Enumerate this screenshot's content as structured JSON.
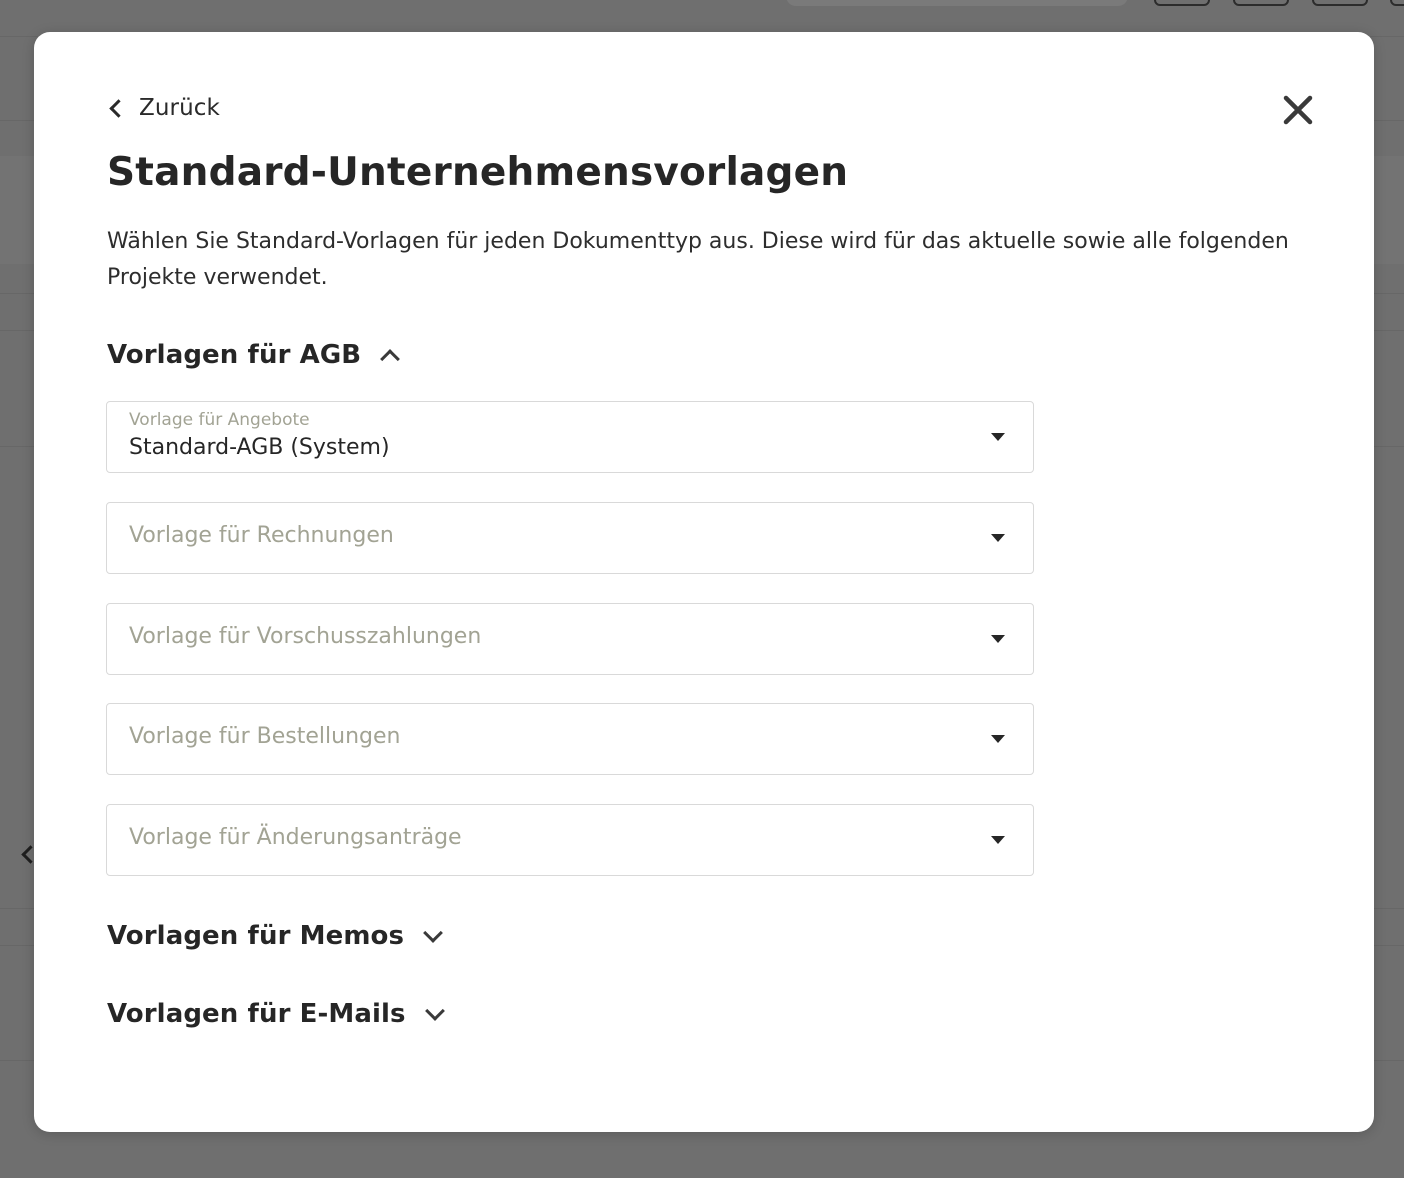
{
  "modal": {
    "back_label": "Zurück",
    "title": "Standard-Unternehmensvorlagen",
    "description": "Wählen Sie Standard-Vorlagen für jeden Dokumenttyp aus. Diese wird für das aktuelle sowie alle folgenden Projekte verwendet."
  },
  "sections": [
    {
      "label": "Vorlagen für AGB",
      "expanded": true,
      "toggle_icon": "chevron-up-icon",
      "selects": [
        {
          "label": "Vorlage für Angebote",
          "value": "Standard-AGB (System)"
        },
        {
          "placeholder": "Vorlage für Rechnungen"
        },
        {
          "placeholder": "Vorlage für Vorschusszahlungen"
        },
        {
          "placeholder": "Vorlage für Bestellungen"
        },
        {
          "placeholder": "Vorlage für Änderungsanträge"
        }
      ]
    },
    {
      "label": "Vorlagen für Memos",
      "expanded": false,
      "toggle_icon": "chevron-down-icon"
    },
    {
      "label": "Vorlagen für E-Mails",
      "expanded": false,
      "toggle_icon": "chevron-down-icon"
    }
  ],
  "colors": {
    "overlay": "#6f6f6f",
    "text_primary": "#262626",
    "placeholder": "#a2a394",
    "field_border": "#d9d9d9"
  }
}
